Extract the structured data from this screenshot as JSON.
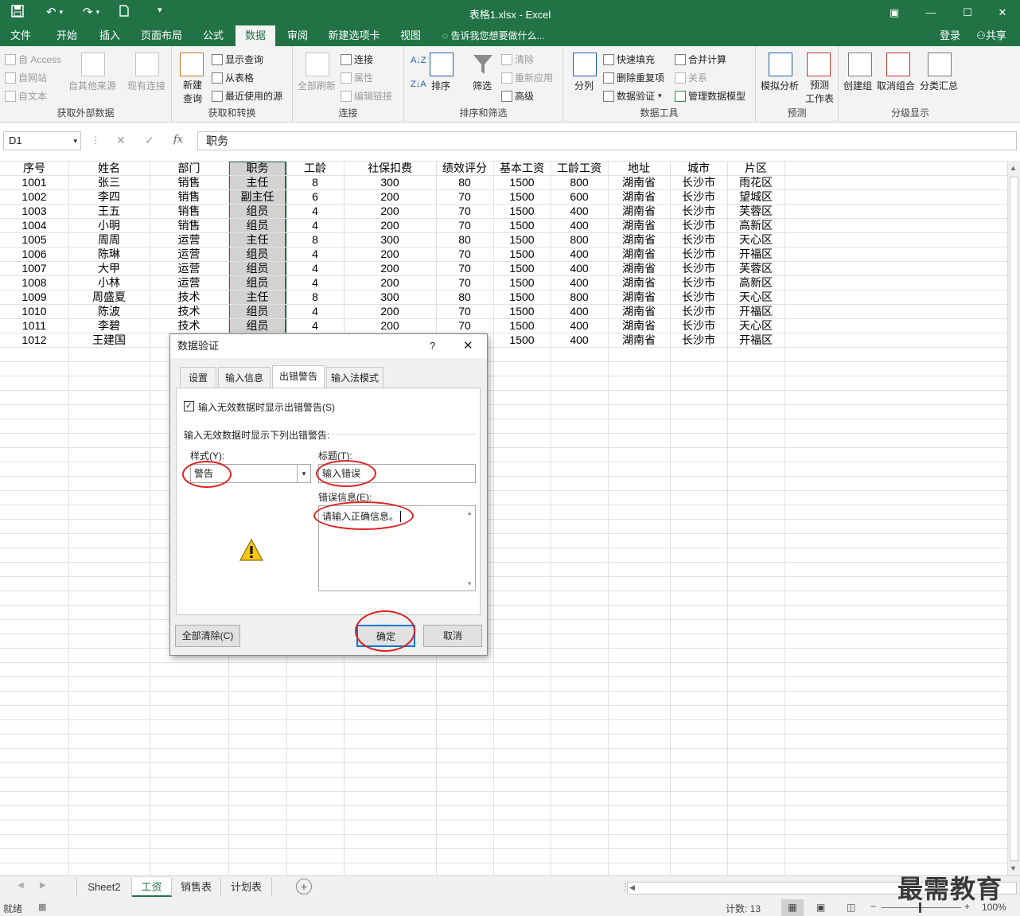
{
  "window": {
    "title": "表格1.xlsx - Excel",
    "signin": "登录",
    "share": "共享"
  },
  "menu": {
    "tabs": [
      "文件",
      "开始",
      "插入",
      "页面布局",
      "公式",
      "数据",
      "审阅",
      "新建选项卡",
      "视图"
    ],
    "active": "数据",
    "tell_me": "告诉我您想要做什么..."
  },
  "ribbon": {
    "get_external": {
      "label": "获取外部数据",
      "access": "自 Access",
      "web": "自网站",
      "text": "自文本",
      "other": "自其他来源",
      "existing": "现有连接"
    },
    "get_transform": {
      "label": "获取和转换",
      "new_query_1": "新建",
      "new_query_2": "查询",
      "show_queries": "显示查询",
      "from_table": "从表格",
      "recent_sources": "最近使用的源"
    },
    "connections": {
      "label": "连接",
      "refresh_all": "全部刷新",
      "connections": "连接",
      "properties": "属性",
      "edit_links": "编辑链接"
    },
    "sort_filter": {
      "label": "排序和筛选",
      "sort": "排序",
      "filter": "筛选",
      "clear": "清除",
      "reapply": "重新应用",
      "advanced": "高级"
    },
    "data_tools": {
      "label": "数据工具",
      "text_to_columns": "分列",
      "flash_fill": "快速填充",
      "remove_duplicates": "删除重复项",
      "data_validation": "数据验证",
      "consolidate": "合并计算",
      "relationships": "关系",
      "manage_model": "管理数据模型"
    },
    "forecast": {
      "label": "预测",
      "what_if": "模拟分析",
      "forecast_sheet_1": "预测",
      "forecast_sheet_2": "工作表"
    },
    "outline": {
      "label": "分级显示",
      "group": "创建组",
      "ungroup": "取消组合",
      "subtotal": "分类汇总"
    }
  },
  "formula_bar": {
    "name_box": "D1",
    "fx": "fx",
    "value": "职务"
  },
  "sheet": {
    "headers": [
      "序号",
      "姓名",
      "部门",
      "职务",
      "工龄",
      "社保扣费",
      "绩效评分",
      "基本工资",
      "工龄工资",
      "地址",
      "城市",
      "片区"
    ],
    "rows": [
      [
        "1001",
        "张三",
        "销售",
        "主任",
        "8",
        "300",
        "80",
        "1500",
        "800",
        "湖南省",
        "长沙市",
        "雨花区"
      ],
      [
        "1002",
        "李四",
        "销售",
        "副主任",
        "6",
        "200",
        "70",
        "1500",
        "600",
        "湖南省",
        "长沙市",
        "望城区"
      ],
      [
        "1003",
        "王五",
        "销售",
        "组员",
        "4",
        "200",
        "70",
        "1500",
        "400",
        "湖南省",
        "长沙市",
        "芙蓉区"
      ],
      [
        "1004",
        "小明",
        "销售",
        "组员",
        "4",
        "200",
        "70",
        "1500",
        "400",
        "湖南省",
        "长沙市",
        "高新区"
      ],
      [
        "1005",
        "周周",
        "运营",
        "主任",
        "8",
        "300",
        "80",
        "1500",
        "800",
        "湖南省",
        "长沙市",
        "天心区"
      ],
      [
        "1006",
        "陈琳",
        "运营",
        "组员",
        "4",
        "200",
        "70",
        "1500",
        "400",
        "湖南省",
        "长沙市",
        "开福区"
      ],
      [
        "1007",
        "大甲",
        "运营",
        "组员",
        "4",
        "200",
        "70",
        "1500",
        "400",
        "湖南省",
        "长沙市",
        "芙蓉区"
      ],
      [
        "1008",
        "小林",
        "运营",
        "组员",
        "4",
        "200",
        "70",
        "1500",
        "400",
        "湖南省",
        "长沙市",
        "高新区"
      ],
      [
        "1009",
        "周盛夏",
        "技术",
        "主任",
        "8",
        "300",
        "80",
        "1500",
        "800",
        "湖南省",
        "长沙市",
        "天心区"
      ],
      [
        "1010",
        "陈波",
        "技术",
        "组员",
        "4",
        "200",
        "70",
        "1500",
        "400",
        "湖南省",
        "长沙市",
        "开福区"
      ],
      [
        "1011",
        "李碧",
        "技术",
        "组员",
        "4",
        "200",
        "70",
        "1500",
        "400",
        "湖南省",
        "长沙市",
        "天心区"
      ],
      [
        "1012",
        "王建国",
        "",
        "",
        "",
        "",
        "",
        "1500",
        "400",
        "湖南省",
        "长沙市",
        "开福区"
      ]
    ]
  },
  "sheet_tabs": {
    "tabs": [
      "Sheet2",
      "工资",
      "销售表",
      "计划表"
    ],
    "active": "工资"
  },
  "status": {
    "ready": "就绪",
    "count": "计数: 13",
    "zoom": "100%"
  },
  "dialog": {
    "title": "数据验证",
    "help": "?",
    "close": "✕",
    "tabs": [
      "设置",
      "输入信息",
      "出错警告",
      "输入法模式"
    ],
    "active_tab": "出错警告",
    "show_alert_label": "输入无效数据时显示出错警告(S)",
    "show_alert_checked": true,
    "section_label": "输入无效数据时显示下列出错警告:",
    "style_label": "样式(Y):",
    "style_value": "警告",
    "title_label": "标题(T):",
    "title_value": "输入错误",
    "message_label": "错误信息(E):",
    "message_value": "请输入正确信息。",
    "clear_all": "全部清除(C)",
    "ok": "确定",
    "cancel": "取消"
  },
  "watermark": "最需教育"
}
